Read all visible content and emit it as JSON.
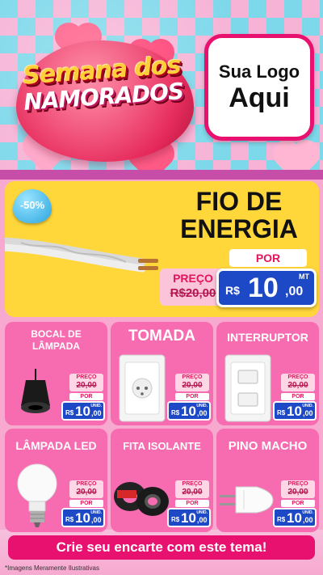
{
  "header": {
    "title_line1": "Semana dos",
    "title_line2": "NAMORADOS",
    "logo_line1": "Sua Logo",
    "logo_line2": "Aqui"
  },
  "featured": {
    "badge": "-50%",
    "name": "FIO DE ENERGIA",
    "old_label": "PREÇO",
    "old_price": "R$20,00",
    "por_label": "POR",
    "currency": "R$",
    "price_int": "10",
    "price_cents": ",00",
    "unit": "MT"
  },
  "products": [
    {
      "name": "BOCAL DE LÂMPADA",
      "img": "bulb-socket-icon",
      "old_label": "PREÇO",
      "old_price": "20,00",
      "por_label": "POR",
      "currency": "R$",
      "price_int": "10",
      "price_cents": ",00",
      "unit": "UNID."
    },
    {
      "name": "TOMADA",
      "img": "outlet-icon",
      "old_label": "PREÇO",
      "old_price": "20,00",
      "por_label": "POR",
      "currency": "R$",
      "price_int": "10",
      "price_cents": ",00",
      "unit": "UNID."
    },
    {
      "name": "INTERRUPTOR",
      "img": "switch-icon",
      "old_label": "PREÇO",
      "old_price": "20,00",
      "por_label": "POR",
      "currency": "R$",
      "price_int": "10",
      "price_cents": ",00",
      "unit": "UNID."
    },
    {
      "name": "LÂMPADA LED",
      "img": "led-bulb-icon",
      "old_label": "PREÇO",
      "old_price": "20,00",
      "por_label": "POR",
      "currency": "R$",
      "price_int": "10",
      "price_cents": ",00",
      "unit": "UNID."
    },
    {
      "name": "FITA ISOLANTE",
      "img": "tape-icon",
      "old_label": "PREÇO",
      "old_price": "20,00",
      "por_label": "POR",
      "currency": "R$",
      "price_int": "10",
      "price_cents": ",00",
      "unit": "UNID."
    },
    {
      "name": "PINO MACHO",
      "img": "plug-icon",
      "old_label": "PREÇO",
      "old_price": "20,00",
      "por_label": "POR",
      "currency": "R$",
      "price_int": "10",
      "price_cents": ",00",
      "unit": "UNID."
    }
  ],
  "footer": {
    "cta": "Crie seu encarte com este tema!",
    "disclaimer": "*Imagens Meramente Ilustrativas"
  },
  "colors": {
    "pink": "#f76bb0",
    "magenta": "#e8116f",
    "yellow": "#ffd73a",
    "blue": "#1d49c7"
  }
}
